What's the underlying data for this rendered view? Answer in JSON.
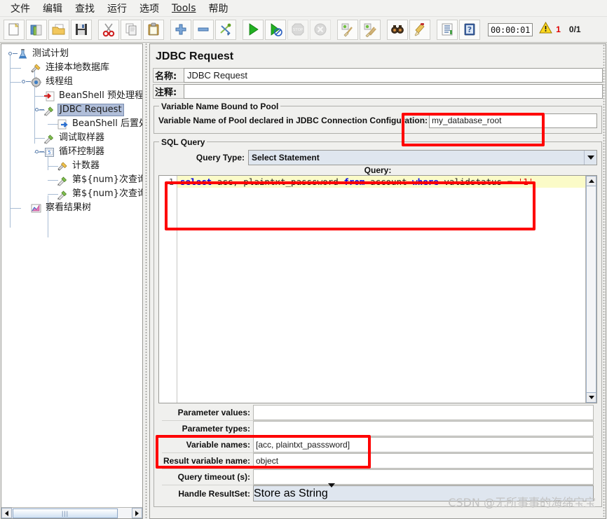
{
  "menu": {
    "items": [
      {
        "label": "文件",
        "underlined": false
      },
      {
        "label": "编辑",
        "underlined": false
      },
      {
        "label": "查找",
        "underlined": false
      },
      {
        "label": "运行",
        "underlined": false
      },
      {
        "label": "选项",
        "underlined": false
      },
      {
        "label": "Tools",
        "underlined": true
      },
      {
        "label": "帮助",
        "underlined": false
      }
    ]
  },
  "toolbar": {
    "buttons": [
      {
        "name": "new-icon",
        "title": "新建"
      },
      {
        "name": "templates-icon",
        "title": "模板"
      },
      {
        "name": "open-icon",
        "title": "打开"
      },
      {
        "name": "save-icon",
        "title": "保存"
      },
      {
        "name": "cut-icon",
        "title": "剪切"
      },
      {
        "name": "copy-icon",
        "title": "复制"
      },
      {
        "name": "paste-icon",
        "title": "粘贴"
      },
      {
        "name": "expand-all-icon",
        "title": "展开"
      },
      {
        "name": "collapse-all-icon",
        "title": "折叠"
      },
      {
        "name": "toggle-icon",
        "title": "切换"
      },
      {
        "name": "start-icon",
        "title": "启动"
      },
      {
        "name": "start-no-pause-icon",
        "title": "无暂停启动"
      },
      {
        "name": "stop-icon",
        "title": "停止"
      },
      {
        "name": "shutdown-icon",
        "title": "关闭"
      },
      {
        "name": "clear-icon",
        "title": "清除"
      },
      {
        "name": "clear-all-icon",
        "title": "清除全部"
      },
      {
        "name": "search-icon",
        "title": "查找"
      },
      {
        "name": "reset-search-icon",
        "title": "重置查找"
      },
      {
        "name": "function-helper-icon",
        "title": "函数助手"
      },
      {
        "name": "help-icon",
        "title": "帮助"
      }
    ],
    "timer": "00:00:01",
    "warning_count": "1",
    "thread_count": "0/1"
  },
  "tree": {
    "nodes": [
      {
        "label": "测试计划",
        "icon": "test-plan-icon",
        "depth": 0,
        "expanded": true,
        "selected": false
      },
      {
        "label": "连接本地数据库",
        "icon": "jdbc-config-icon",
        "depth": 1,
        "expanded": null,
        "selected": false
      },
      {
        "label": "线程组",
        "icon": "thread-group-icon",
        "depth": 1,
        "expanded": true,
        "selected": false
      },
      {
        "label": "BeanShell 预处理程序",
        "icon": "preprocessor-icon",
        "depth": 2,
        "expanded": null,
        "selected": false
      },
      {
        "label": "JDBC Request",
        "icon": "sampler-icon",
        "depth": 2,
        "expanded": true,
        "selected": true
      },
      {
        "label": "BeanShell 后置处理程序",
        "icon": "postprocessor-icon",
        "depth": 3,
        "expanded": null,
        "selected": false
      },
      {
        "label": "调试取样器",
        "icon": "sampler-icon",
        "depth": 2,
        "expanded": null,
        "selected": false
      },
      {
        "label": "循环控制器",
        "icon": "loop-controller-icon",
        "depth": 2,
        "expanded": true,
        "selected": false
      },
      {
        "label": "计数器",
        "icon": "counter-icon",
        "depth": 3,
        "expanded": null,
        "selected": false
      },
      {
        "label": "第${num}次查询_假",
        "icon": "sampler-icon",
        "depth": 3,
        "expanded": null,
        "selected": false
      },
      {
        "label": "第${num}次查询_假",
        "icon": "sampler-icon",
        "depth": 3,
        "expanded": null,
        "selected": false
      },
      {
        "label": "察看结果树",
        "icon": "view-results-tree-icon",
        "depth": 1,
        "expanded": null,
        "selected": false
      }
    ]
  },
  "panel": {
    "title": "JDBC Request",
    "name_label": "名称:",
    "name_value": "JDBC Request",
    "comment_label": "注释:",
    "comment_value": "",
    "pool_group_title": "Variable Name Bound to Pool",
    "pool_label": "Variable Name of Pool declared in JDBC Connection Configuration:",
    "pool_value": "my_database_root",
    "sql_group_title": "SQL Query",
    "query_type_label": "Query Type:",
    "query_type_value": "Select Statement",
    "query_label": "Query:",
    "query_line_number": "1",
    "query_tokens": [
      {
        "text": "select",
        "type": "keyword"
      },
      {
        "text": " acc, plaintxt_passsword ",
        "type": "plain"
      },
      {
        "text": "from",
        "type": "keyword"
      },
      {
        "text": " account ",
        "type": "plain"
      },
      {
        "text": "where",
        "type": "keyword"
      },
      {
        "text": " validstatus = ",
        "type": "plain"
      },
      {
        "text": "'1'",
        "type": "string"
      }
    ],
    "query_text": "select acc, plaintxt_passsword from account where validstatus = '1'",
    "params": [
      {
        "label": "Parameter values:",
        "value": "",
        "type": "input"
      },
      {
        "label": "Parameter types:",
        "value": "",
        "type": "input"
      },
      {
        "label": "Variable names:",
        "value": "[acc, plaintxt_passsword]",
        "type": "input"
      },
      {
        "label": "Result variable name:",
        "value": "object",
        "type": "input"
      },
      {
        "label": "Query timeout (s):",
        "value": "",
        "type": "input"
      },
      {
        "label": "Handle ResultSet:",
        "value": "Store as String",
        "type": "combo"
      }
    ]
  },
  "watermark": "CSDN @无所事事的海绵宝宝",
  "colors": {
    "annotation_red": "#fe0000",
    "selection_blue": "#b0bed9",
    "code_highlight": "#fbfbc8",
    "keyword_blue": "#0000e0",
    "string_red": "#d00000",
    "panel_bg": "#f0f0ee"
  }
}
